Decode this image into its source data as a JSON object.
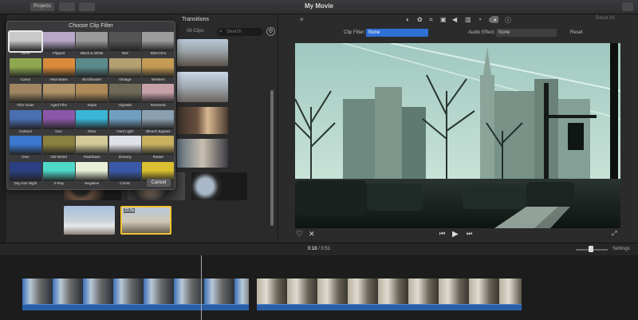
{
  "window": {
    "title": "My Movie"
  },
  "toolbar": {
    "btn1": "Projects",
    "btn2": "",
    "btn3": "",
    "reset_all": "Reset All"
  },
  "browser": {
    "tab_transitions": "Transitions",
    "all_clips": "All Clips",
    "search_placeholder": "Search"
  },
  "clip_filter": {
    "title": "Choose Clip Filter",
    "cancel": "Cancel",
    "filters": [
      "None",
      "Flipped",
      "Black & White",
      "Noir",
      "Silent Era",
      "Camo",
      "Heat Wave",
      "Blockbuster",
      "Vintage",
      "Western",
      "Film Grain",
      "Aged Film",
      "Sepia",
      "Vignette",
      "Romantic",
      "Cartoon",
      "Duo",
      "Glow",
      "Hard Light",
      "Bleach Bypass",
      "Dive",
      "Old World",
      "Flashback",
      "Dreamy",
      "Raster",
      "Day into Night",
      "X-Ray",
      "Negative",
      "Comic",
      "Duotone"
    ],
    "filter_colors": [
      "#c9c9c9",
      "#b8a8c8",
      "#9a9a9a",
      "#555555",
      "#9c9c9c",
      "#8fa84f",
      "#d98b3a",
      "#5a8a8a",
      "#b4a070",
      "#c49a55",
      "#a08660",
      "#b09468",
      "#b08a58",
      "#6e6a58",
      "#c8a0a8",
      "#4a6fb0",
      "#8a58a8",
      "#3bb5d5",
      "#70a0c0",
      "#8aa0b0",
      "#3b78d0",
      "#8a8040",
      "#d2c898",
      "#e0e0e8",
      "#c8b060",
      "#2a4080",
      "#4fd8c8",
      "#e8f0d8",
      "#3a5aa8",
      "#d8c030"
    ],
    "selected_index": 0
  },
  "viewer": {
    "clip_filter_label": "Clip Filter:",
    "clip_filter_value": "None",
    "audio_effect_label": "Audio Effect:",
    "audio_effect_value": "None",
    "reset": "Reset"
  },
  "timeline": {
    "current_time": "0:18",
    "separator": "/",
    "total_time": "0:51",
    "settings": "Settings"
  },
  "clip_duration_badge": "23.8s"
}
